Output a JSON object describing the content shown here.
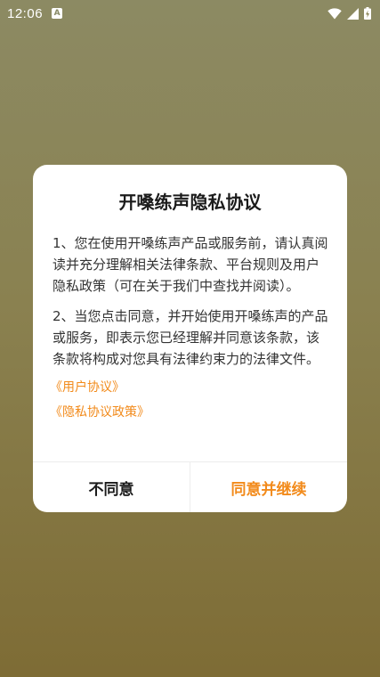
{
  "status_bar": {
    "time": "12:06",
    "notification_glyph": "A",
    "icons": [
      "wifi-icon",
      "signal-icon",
      "battery-charging-icon"
    ],
    "color": "#ffffff"
  },
  "dialog": {
    "title": "开嗓练声隐私协议",
    "paragraphs": [
      "1、您在使用开嗓练声产品或服务前，请认真阅读并充分理解相关法律条款、平台规则及用户隐私政策（可在关于我们中查找并阅读）。",
      "2、当您点击同意，并开始使用开嗓练声的产品或服务，即表示您已经理解并同意该条款，该条款将构成对您具有法律约束力的法律文件。"
    ],
    "links": {
      "user_agreement": "《用户协议》",
      "privacy_policy": "《隐私协议政策》"
    },
    "buttons": {
      "disagree": "不同意",
      "agree": "同意并继续"
    },
    "accent_color": "#f28a1a"
  }
}
